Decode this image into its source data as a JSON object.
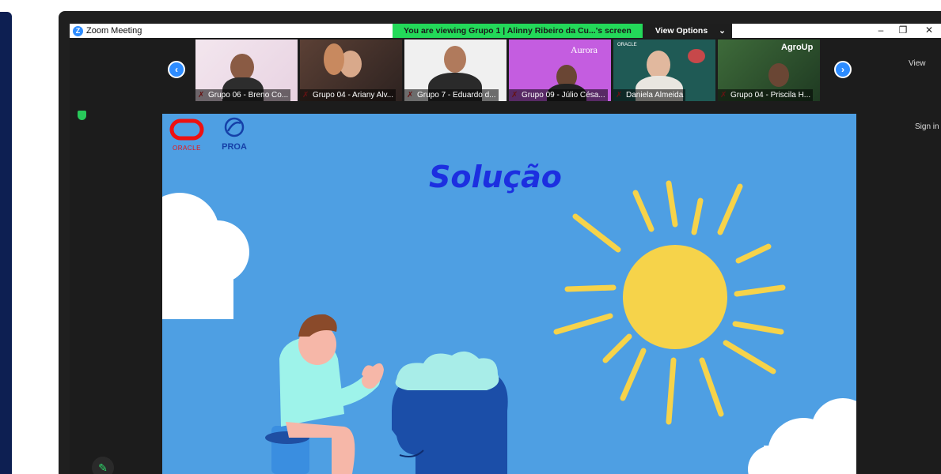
{
  "window": {
    "title": "Zoom Meeting",
    "controls": [
      "minimize-icon",
      "restore-icon",
      "close-icon"
    ]
  },
  "share_banner": {
    "text": "You are viewing Grupo 1 | Alinny Ribeiro da Cu...'s screen",
    "view_options_label": "View Options",
    "view_options_icon": "chevron-down-icon"
  },
  "gallery": {
    "participants": [
      {
        "name": "Grupo 06 - Breno Co...",
        "muted": true
      },
      {
        "name": "Grupo 04 - Ariany Alv...",
        "muted": true
      },
      {
        "name": "Grupo 7 - Eduardo d...",
        "muted": true
      },
      {
        "name": "Grupo 09 - Júlio Césa...",
        "muted": true
      },
      {
        "name": "Daniela Almeida",
        "muted": true
      },
      {
        "name": "Grupo 04 - Priscila H...",
        "muted": true
      }
    ],
    "thumb_texts": {
      "aurora": "Aurora",
      "oracle_small": "ORACLE",
      "agroup": "AgroUp"
    }
  },
  "side": {
    "view_label": "View",
    "sign_in_label": "Sign in"
  },
  "slide": {
    "title": "Solução",
    "oracle_logo_text": "ORACLE",
    "proa_logo_text": "PROA"
  },
  "colors": {
    "banner_green": "#23d959",
    "zoom_blue": "#2d8cff",
    "slide_bg": "#4e9fe3",
    "title_blue": "#1c2fe0",
    "sun_yellow": "#f6d34a"
  }
}
